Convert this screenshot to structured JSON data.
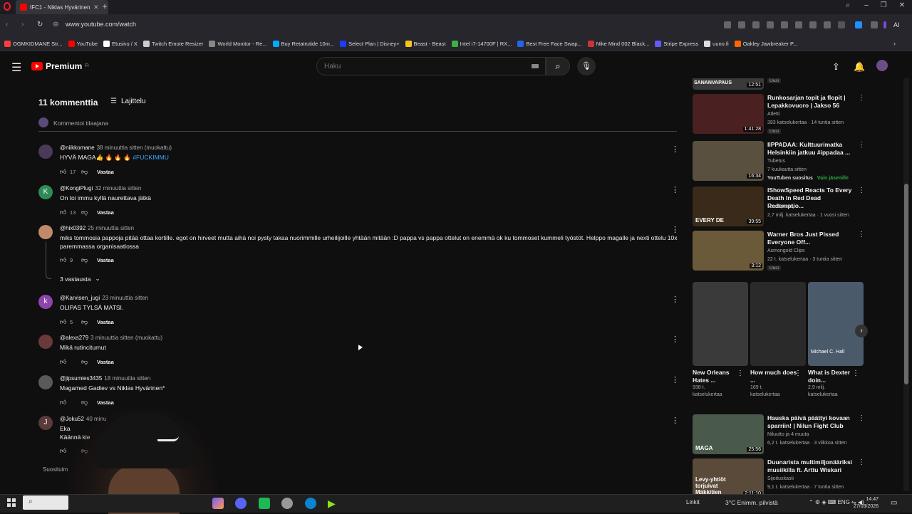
{
  "browser": {
    "tab_title": "IFC1 - Niklas Hyvärinen",
    "url": "www.youtube.com/watch",
    "bookmarks": [
      {
        "label": "OGMKIDMANE Str...",
        "color": "#ff3d3d"
      },
      {
        "label": "YouTube",
        "color": "#ff0000"
      },
      {
        "label": "Etusivu / X",
        "color": "#ffffff"
      },
      {
        "label": "Twitch Emote Resizer",
        "color": "#cccccc"
      },
      {
        "label": "World Monitor - Re...",
        "color": "#888888"
      },
      {
        "label": "Buy Retatrutide 10m...",
        "color": "#00aaff"
      },
      {
        "label": "Select Plan | Disney+",
        "color": "#1a3cff"
      },
      {
        "label": "Beast - Beast",
        "color": "#f5c518"
      },
      {
        "label": "Intel i7-14700F | RX...",
        "color": "#3cb043"
      },
      {
        "label": "Best Free Face Swap...",
        "color": "#2563eb"
      },
      {
        "label": "Nike Mind 002 Black...",
        "color": "#cc3333"
      },
      {
        "label": "Stripe Express",
        "color": "#635bff"
      },
      {
        "label": "uuno.fi",
        "color": "#dddddd"
      },
      {
        "label": "Oakley Jawbreaker P...",
        "color": "#ff6600"
      }
    ],
    "ai_label": "AI"
  },
  "yt": {
    "premium_label": "Premium",
    "premium_sup": "FI",
    "search_placeholder": "Haku"
  },
  "comments": {
    "count_label": "11 kommenttia",
    "sort_label": "Lajittelu",
    "add_placeholder": "Kommentoi tilaajana",
    "reply_label": "Vastaa",
    "replies_toggle": "3 vastausta",
    "items": [
      {
        "user": "@niikkomane",
        "time": "38 minuuttia sitten (muokattu)",
        "text": "HYVÄ MAGA👍 🔥 🔥 🔥 ",
        "tag": "#FUCKIMMU",
        "likes": "17",
        "avatar_letter": "",
        "avatar_color": "#4a3a5a"
      },
      {
        "user": "@KongiPlugi",
        "time": "32 minuuttia sitten",
        "text": "On toi immu kyllä naurettava jätkä",
        "tag": "",
        "likes": "13",
        "avatar_letter": "K",
        "avatar_color": "#2e8b57"
      },
      {
        "user": "@hix0392",
        "time": "25 minuuttia sitten",
        "text": "miks tommosia pappoja pitää ottaa kortille. egot on hirveet mutta aihä noi pysty takaa nuorimmille urheilijoille yhtään mitään :D pappa vs pappa ottelut on enemmä ok ku tommoset kummeli työstöt. Helppo magalle ja nexti ottelu 10x paremmassa organisaatiossa",
        "tag": "",
        "likes": "9",
        "avatar_letter": "",
        "avatar_color": "#c08a6a"
      },
      {
        "user": "@Karvisen_jugi",
        "time": "23 minuuttia sitten",
        "text": "OLIPAS TYLSÄ MATSI.",
        "tag": "",
        "likes": "5",
        "avatar_letter": "k",
        "avatar_color": "#8e44ad"
      },
      {
        "user": "@alexs279",
        "time": "3 minuuttia sitten (muokattu)",
        "text": "Mikä rutinciturnut",
        "tag": "",
        "likes": "",
        "avatar_letter": "",
        "avatar_color": "#6a3a3a"
      },
      {
        "user": "@jipsumies3435",
        "time": "18 minuuttia sitten",
        "text": "Magamed Gadiev vs Niklas Hyvärinen*",
        "tag": "",
        "likes": "",
        "avatar_letter": "",
        "avatar_color": "#5a5a5a"
      },
      {
        "user": "@Joku52",
        "time": "40 minu",
        "text": "Eka",
        "text2": "Käännä kie",
        "tag": "",
        "likes": "",
        "avatar_letter": "J",
        "avatar_color": "#5b3a3a"
      }
    ],
    "suosit_label": "Suosituim"
  },
  "sidebar": {
    "top_partial": {
      "title": "SANANVAPAUS",
      "dur": "12:51",
      "badge": "Uusi"
    },
    "videos": [
      {
        "title": "Runkosarjan topit ja flopit | Lepakkovuoro | Jakso 56",
        "channel": "Atletti",
        "meta": "393 katselukertaa · 14 tuntia sitten",
        "badge": "Uusi",
        "dur": "1:41:28",
        "thumb": "#4a2020"
      },
      {
        "title": "IIPPADAA: Kulttuurimatka Helsinkiin jatkuu #ippadaa ...",
        "channel": "Tubetus",
        "meta": "7 kuukautta sitten",
        "extra": "YouTuben suositus",
        "member": "Vain jäsenille",
        "dur": "16:34",
        "thumb": "#5a5040"
      },
      {
        "title": "IShowSpeed Reacts To Every Death In Red Dead Redemptio...",
        "channel": "Live Speedy",
        "meta": "2,7 milj. katselukertaa · 1 vuosi sitten",
        "dur": "39:55",
        "thumb": "#3a2a1a",
        "overlay": "EVERY DE"
      },
      {
        "title": "Warner Bros Just Pissed Everyone Off...",
        "channel": "Asmongold Clips",
        "meta": "22 t. katselukertaa · 3 tuntia sitten",
        "badge": "Uusi",
        "dur": "3:12",
        "thumb": "#6a5a3a"
      },
      {
        "title": "Hauska päivä päättyi kovaan sparriin! | Nilun Fight Club",
        "channel": "Niluutto ja 4 muuta",
        "meta": "6,2 t. katselukertaa · 3 viikkoa sitten",
        "dur": "25:56",
        "thumb": "#4a5a4a",
        "overlay": "MAGA"
      },
      {
        "title": "Duunarista multimiljonääriksi musiikilla ft. Arttu Wiskari",
        "channel": "Sijoituskasti",
        "meta": "9,1 t. katselukertaa · 7 tuntia sitten",
        "dur": "2:11:10",
        "thumb": "#5a4a3a",
        "overlay": "Levy-yhtiöt torjuivat Mäkkitien"
      }
    ],
    "shorts": [
      {
        "title": "New Orleans Hates ...",
        "meta1": "938 t.",
        "meta2": "katselukertaa",
        "thumb": "#3a3a3a"
      },
      {
        "title": "How much does ...",
        "meta1": "169 t.",
        "meta2": "katselukertaa",
        "thumb": "#2a2a2a"
      },
      {
        "title": "What is Dexter doin...",
        "meta1": "2,9 milj.",
        "meta2": "katselukertaa",
        "thumb": "#4a5a6a",
        "overlay": "Michael C. Hall"
      }
    ]
  },
  "taskbar": {
    "links_label": "Linkit",
    "weather": "3°C  Enimm. pilvistä",
    "lang": "ENG",
    "time": "14.47",
    "date": "27/03/2026"
  }
}
